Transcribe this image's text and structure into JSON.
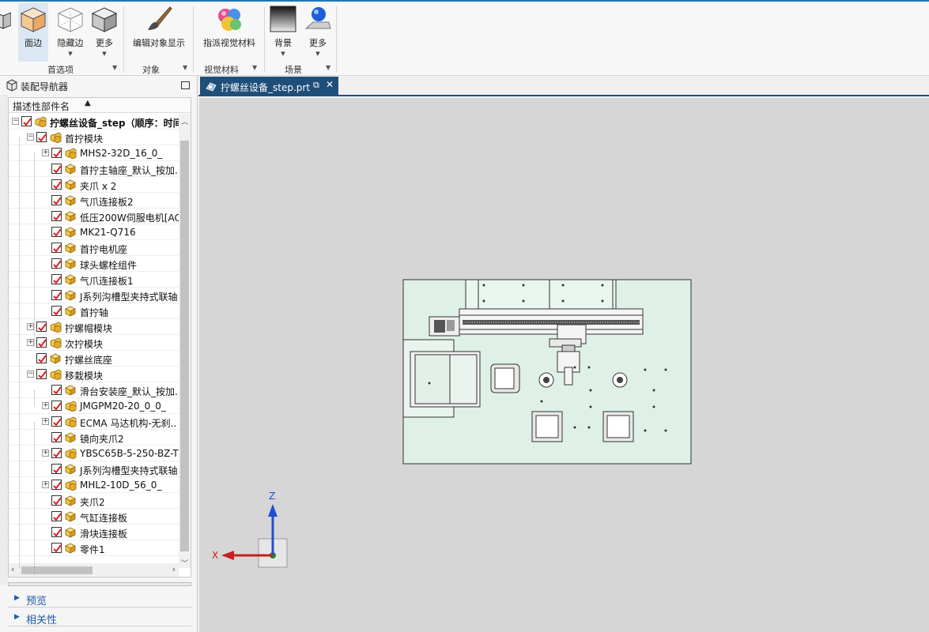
{
  "ribbon": {
    "buttons": [
      {
        "label": "面边",
        "active": true
      },
      {
        "label": "隐藏边"
      },
      {
        "label": "更多"
      },
      {
        "label": "编辑对象显示"
      },
      {
        "label": "指派视觉材料"
      },
      {
        "label": "背景"
      },
      {
        "label": "更多"
      }
    ],
    "groups": [
      "首选项",
      "对象",
      "视觉材料",
      "场景"
    ]
  },
  "navigator": {
    "title": "装配导航器",
    "column_header": "描述性部件名",
    "panels": [
      "预览",
      "相关性"
    ],
    "rows": [
      {
        "label": "拧螺丝设备_step（顺序：时间"
      },
      {
        "label": "首拧模块"
      },
      {
        "label": "MHS2-32D_16_0_"
      },
      {
        "label": "首拧主轴座_默认_按加."
      },
      {
        "label": "夹爪 x 2"
      },
      {
        "label": "气爪连接板2"
      },
      {
        "label": "低压200W伺服电机[AC"
      },
      {
        "label": "MK21-Q716"
      },
      {
        "label": "首拧电机座"
      },
      {
        "label": "球头螺栓组件"
      },
      {
        "label": "气爪连接板1"
      },
      {
        "label": "J系列沟槽型夹持式联轴"
      },
      {
        "label": "首拧轴"
      },
      {
        "label": "拧螺帽模块"
      },
      {
        "label": "次拧模块"
      },
      {
        "label": "拧螺丝底座"
      },
      {
        "label": "移栽模块"
      },
      {
        "label": "滑台安装座_默认_按加."
      },
      {
        "label": "JMGPM20-20_0_0_"
      },
      {
        "label": "ECMA 马达机构-无刹.."
      },
      {
        "label": "镜向夹爪2"
      },
      {
        "label": "YBSC65B-5-250-BZ-T"
      },
      {
        "label": "J系列沟槽型夹持式联轴"
      },
      {
        "label": "MHL2-10D_56_0_"
      },
      {
        "label": "夹爪2"
      },
      {
        "label": "气缸连接板"
      },
      {
        "label": "滑块连接板"
      },
      {
        "label": "零件1"
      }
    ]
  },
  "tab": {
    "label": "拧螺丝设备_step.prt"
  },
  "triad": {
    "z": "Z",
    "x": "X"
  },
  "colors": {
    "accent": "#1f4e79",
    "check": "#e02020",
    "model_fill": "#dff0e6",
    "viewport": "#d6d6d6"
  }
}
